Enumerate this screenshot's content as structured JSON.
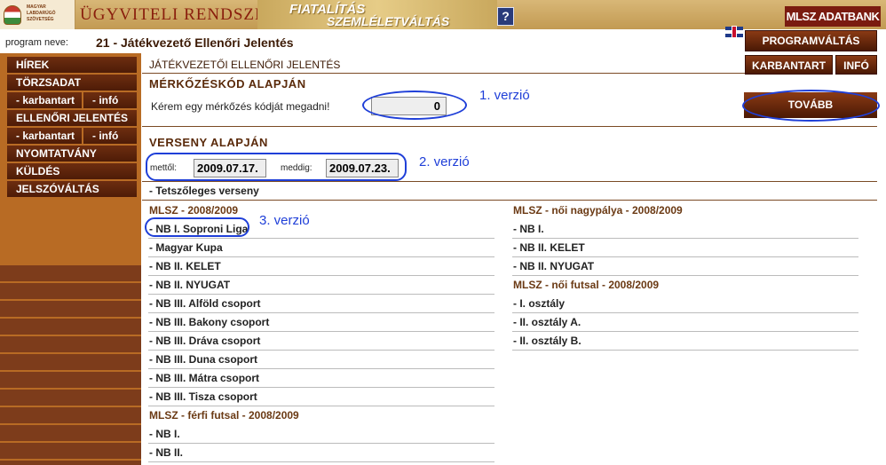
{
  "banner": {
    "logo_text": "MAGYAR LABDARÚGÓ SZÖVETSÉG",
    "system_title": "ÜGYVITELI RENDSZER",
    "slogan_1": "FIATALÍTÁS",
    "slogan_2": "SZEMLÉLETVÁLTÁS",
    "help": "?",
    "adatbank": "MLSZ ADATBANK"
  },
  "program": {
    "label": "program neve:",
    "value": "21 - Játékvezető Ellenőri Jelentés"
  },
  "top_buttons": {
    "programvaltas": "PROGRAMVÁLTÁS",
    "karbantart": "KARBANTART",
    "info": "INFÓ"
  },
  "sidebar": {
    "hirek": "HÍREK",
    "torzsadat": "TÖRZSADAT",
    "torzs_karbantart": "- karbantart",
    "torzs_info": "- infó",
    "ellenori": "ELLENŐRI JELENTÉS",
    "ell_karbantart": "- karbantart",
    "ell_info": "- infó",
    "nyomtatvany": "NYOMTATVÁNY",
    "kuldes": "KÜLDÉS",
    "jelszovaltas": "JELSZÓVÁLTÁS"
  },
  "main": {
    "header": "JÁTÉKVEZETŐI ELLENŐRI JELENTÉS",
    "code_section": "MÉRKŐZÉSKÓD ALAPJÁN",
    "code_label": "Kérem egy mérkőzés kódját megadni!",
    "code_value": "0",
    "tovabb": "TOVÁBB",
    "comp_section": "VERSENY ALAPJÁN",
    "from_label": "mettől:",
    "from_value": "2009.07.17.",
    "to_label": "meddig:",
    "to_value": "2009.07.23.",
    "any_comp": "- Tetszőleges verseny"
  },
  "annotations": {
    "v1": "1. verzió",
    "v2": "2. verzió",
    "v3": "3. verzió"
  },
  "left_groups": [
    {
      "title": "MLSZ - 2008/2009",
      "items": [
        "- NB I. Soproni Liga",
        "- Magyar Kupa",
        "- NB II. KELET",
        "- NB II. NYUGAT",
        "- NB III. Alföld csoport",
        "- NB III. Bakony csoport",
        "- NB III. Dráva csoport",
        "- NB III. Duna csoport",
        "- NB III. Mátra csoport",
        "- NB III. Tisza csoport"
      ]
    },
    {
      "title": "MLSZ - férfi futsal - 2008/2009",
      "items": [
        "- NB I.",
        "- NB II."
      ]
    }
  ],
  "right_groups": [
    {
      "title": "MLSZ - női nagypálya - 2008/2009",
      "items": [
        "- NB I.",
        "- NB II. KELET",
        "- NB II. NYUGAT"
      ]
    },
    {
      "title": "MLSZ - női futsal - 2008/2009",
      "items": [
        "- I. osztály",
        "- II. osztály A.",
        "- II. osztály B."
      ]
    }
  ]
}
